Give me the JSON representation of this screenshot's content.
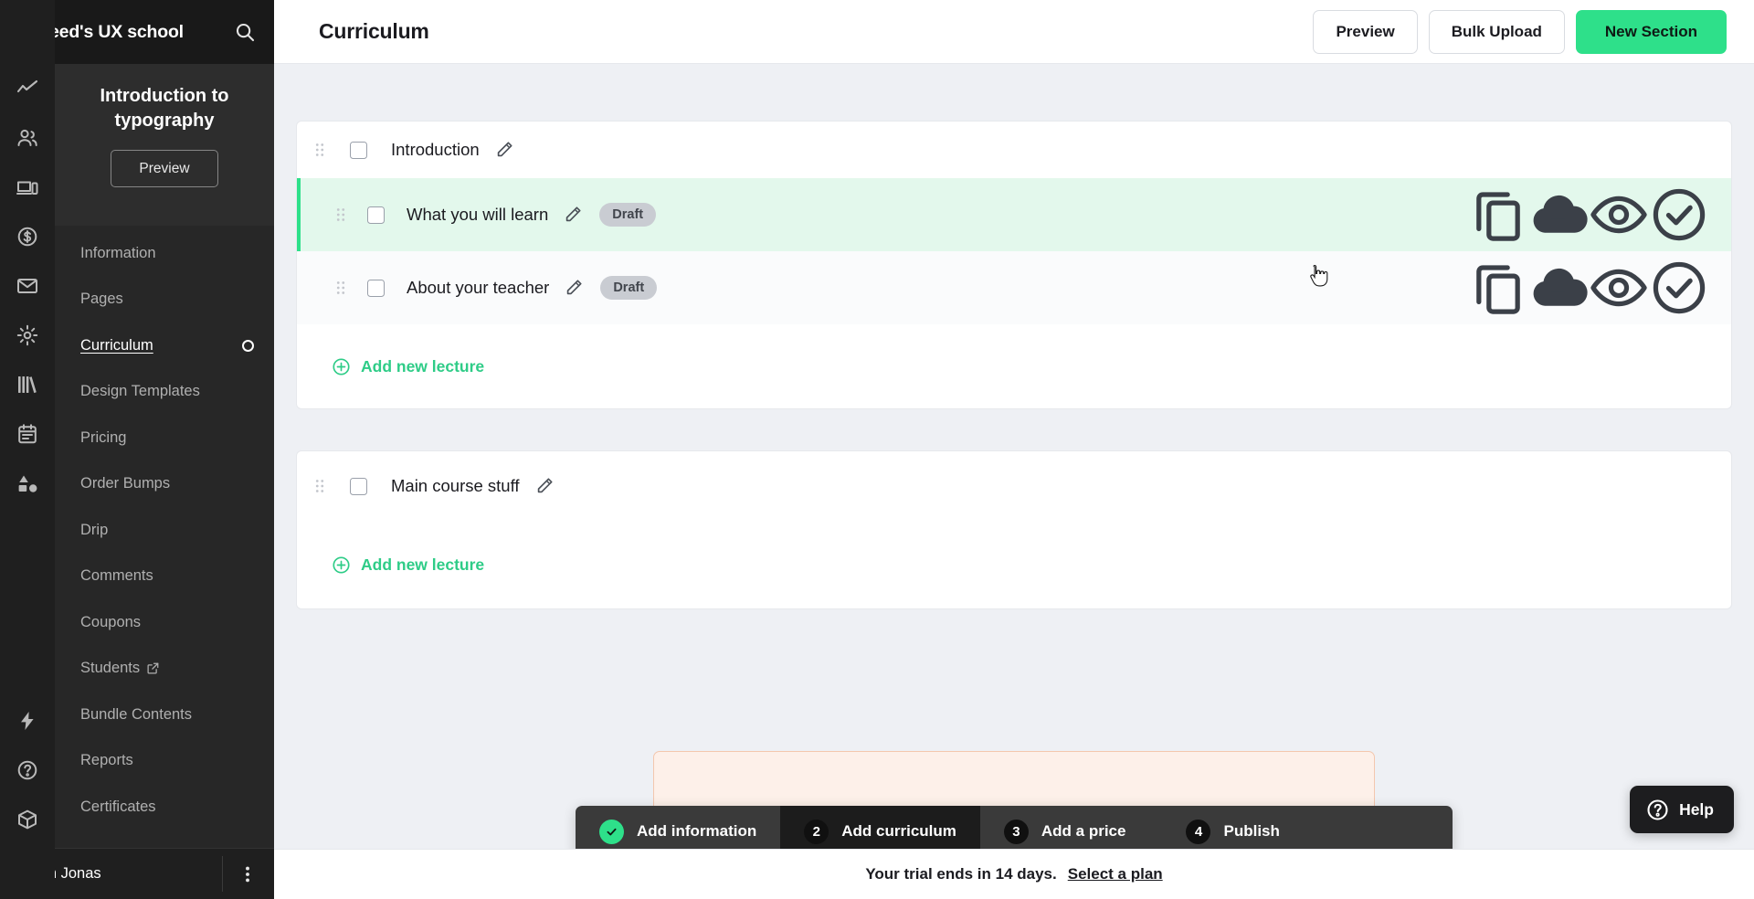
{
  "brand": {
    "title": "UI Feed's UX school",
    "search_icon": "search-icon"
  },
  "course": {
    "title": "Introduction to typography",
    "preview_label": "Preview"
  },
  "rail_icons": [
    "analytics-trend-icon",
    "people-icon",
    "devices-icon",
    "dollar-circle-icon",
    "mail-icon",
    "gear-icon",
    "books-icon",
    "calendar-list-icon",
    "shapes-icon",
    "lightning-icon",
    "help-circle-icon",
    "cube-icon"
  ],
  "sidebar": {
    "items": [
      {
        "label": "Information",
        "active": false,
        "external": false,
        "dot": false
      },
      {
        "label": "Pages",
        "active": false,
        "external": false,
        "dot": false
      },
      {
        "label": "Curriculum",
        "active": true,
        "external": false,
        "dot": true
      },
      {
        "label": "Design Templates",
        "active": false,
        "external": false,
        "dot": false
      },
      {
        "label": "Pricing",
        "active": false,
        "external": false,
        "dot": false
      },
      {
        "label": "Order Bumps",
        "active": false,
        "external": false,
        "dot": false
      },
      {
        "label": "Drip",
        "active": false,
        "external": false,
        "dot": false
      },
      {
        "label": "Comments",
        "active": false,
        "external": false,
        "dot": false
      },
      {
        "label": "Coupons",
        "active": false,
        "external": false,
        "dot": false
      },
      {
        "label": "Students",
        "active": false,
        "external": true,
        "dot": false
      },
      {
        "label": "Bundle Contents",
        "active": false,
        "external": false,
        "dot": false
      },
      {
        "label": "Reports",
        "active": false,
        "external": false,
        "dot": false
      },
      {
        "label": "Certificates",
        "active": false,
        "external": false,
        "dot": false
      }
    ]
  },
  "user": {
    "name": "Sarah Jonas",
    "menu_icon": "kebab-menu-icon"
  },
  "header": {
    "title": "Curriculum",
    "preview_label": "Preview",
    "bulk_upload_label": "Bulk Upload",
    "new_section_label": "New Section"
  },
  "sections": [
    {
      "title": "Introduction",
      "add_lecture_label": "Add new lecture",
      "lectures": [
        {
          "title": "What you will learn",
          "status": "Draft",
          "highlighted": true
        },
        {
          "title": "About your teacher",
          "status": "Draft",
          "highlighted": false
        }
      ]
    },
    {
      "title": "Main course stuff",
      "add_lecture_label": "Add new lecture",
      "lectures": []
    }
  ],
  "row_actions": [
    "duplicate-icon",
    "cloud-download-icon",
    "eye-icon",
    "check-circle-icon"
  ],
  "stepper": {
    "steps": [
      {
        "num": "1",
        "label": "Add information",
        "state": "done"
      },
      {
        "num": "2",
        "label": "Add curriculum",
        "state": "current"
      },
      {
        "num": "3",
        "label": "Add a price",
        "state": "todo"
      },
      {
        "num": "4",
        "label": "Publish",
        "state": "todo"
      }
    ]
  },
  "trial": {
    "text": "Your trial ends in 14 days.",
    "link": "Select a plan"
  },
  "help": {
    "label": "Help",
    "icon": "question-circle-icon"
  },
  "colors": {
    "accent_green": "#2ee08a",
    "link_green": "#2ecc87",
    "highlight_row": "#e3f8ec",
    "rail_bg": "#1f1f1f",
    "sidebar_bg": "#272727",
    "canvas_bg": "#eef0f4",
    "badge_bg": "#c9ccd2",
    "alert_bg": "#fdf0e9"
  }
}
